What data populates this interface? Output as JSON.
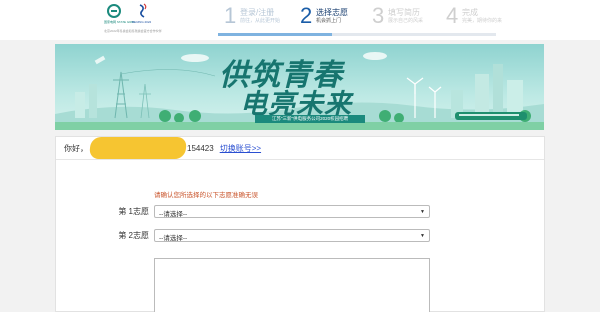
{
  "header": {
    "logo": {
      "sgcc_text": "国家电网 STATE GRID",
      "games_text": "BEIJING 2022",
      "caption": "北京2022年冬奥会和冬残奥会官方合作伙伴"
    },
    "progress_fraction": 0.41,
    "steps": [
      {
        "num": "1",
        "title": "登录/注册",
        "subtitle": "前往，从此更开始"
      },
      {
        "num": "2",
        "title": "选择志愿",
        "subtitle": "机会抓上门"
      },
      {
        "num": "3",
        "title": "填写简历",
        "subtitle": "展示自己的风采"
      },
      {
        "num": "4",
        "title": "完成",
        "subtitle": "完美，期待你的来"
      }
    ]
  },
  "banner": {
    "line1": "供筑青春",
    "line2": "电亮未来",
    "subtitle": "江苏\"三新\"供电服务公司2020校园招聘"
  },
  "user": {
    "greeting": "你好，",
    "id_suffix": "154423",
    "switch_link": "切换账号>>"
  },
  "form": {
    "notice": "请确认您所选择的以下志愿准确无误",
    "choices": [
      {
        "label": "第 1志愿",
        "value": "--请选择--"
      },
      {
        "label": "第 2志愿",
        "value": "--请选择--"
      }
    ],
    "caret": "▼"
  },
  "colors": {
    "accent_blue": "#1a5da8",
    "brand_teal": "#1b8a7d",
    "link": "#2a4fd1",
    "notice": "#c9542b",
    "redaction": "#f6c531"
  }
}
